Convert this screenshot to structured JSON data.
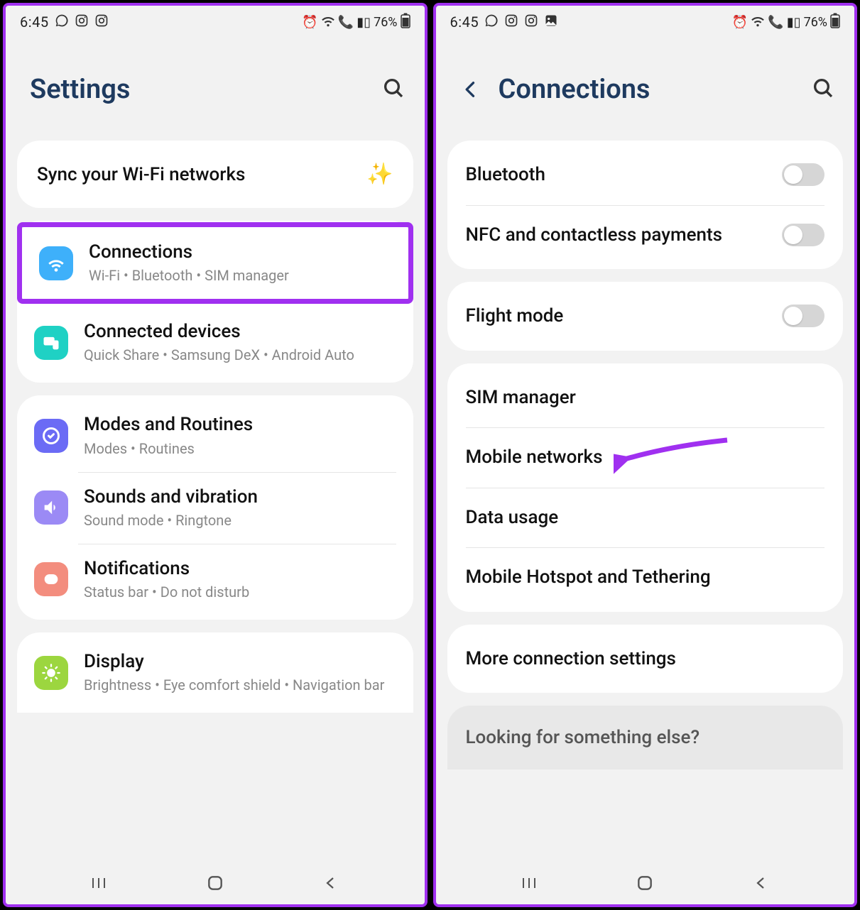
{
  "status": {
    "time": "6:45",
    "battery": "76%"
  },
  "left": {
    "title": "Settings",
    "promo": "Sync your Wi-Fi networks",
    "items": [
      {
        "title": "Connections",
        "sub": "Wi-Fi  •  Bluetooth  •  SIM manager"
      },
      {
        "title": "Connected devices",
        "sub": "Quick Share  •  Samsung DeX  •  Android Auto"
      },
      {
        "title": "Modes and Routines",
        "sub": "Modes  •  Routines"
      },
      {
        "title": "Sounds and vibration",
        "sub": "Sound mode  •  Ringtone"
      },
      {
        "title": "Notifications",
        "sub": "Status bar  •  Do not disturb"
      },
      {
        "title": "Display",
        "sub": "Brightness  •  Eye comfort shield  •  Navigation bar"
      }
    ]
  },
  "right": {
    "title": "Connections",
    "groups": {
      "g1": [
        {
          "title": "Bluetooth",
          "toggle": true
        },
        {
          "title": "NFC and contactless payments",
          "toggle": true
        }
      ],
      "g2": [
        {
          "title": "Flight mode",
          "toggle": true
        }
      ],
      "g3": [
        {
          "title": "SIM manager"
        },
        {
          "title": "Mobile networks"
        },
        {
          "title": "Data usage"
        },
        {
          "title": "Mobile Hotspot and Tethering"
        }
      ],
      "g4": [
        {
          "title": "More connection settings"
        }
      ]
    },
    "looking": "Looking for something else?"
  }
}
